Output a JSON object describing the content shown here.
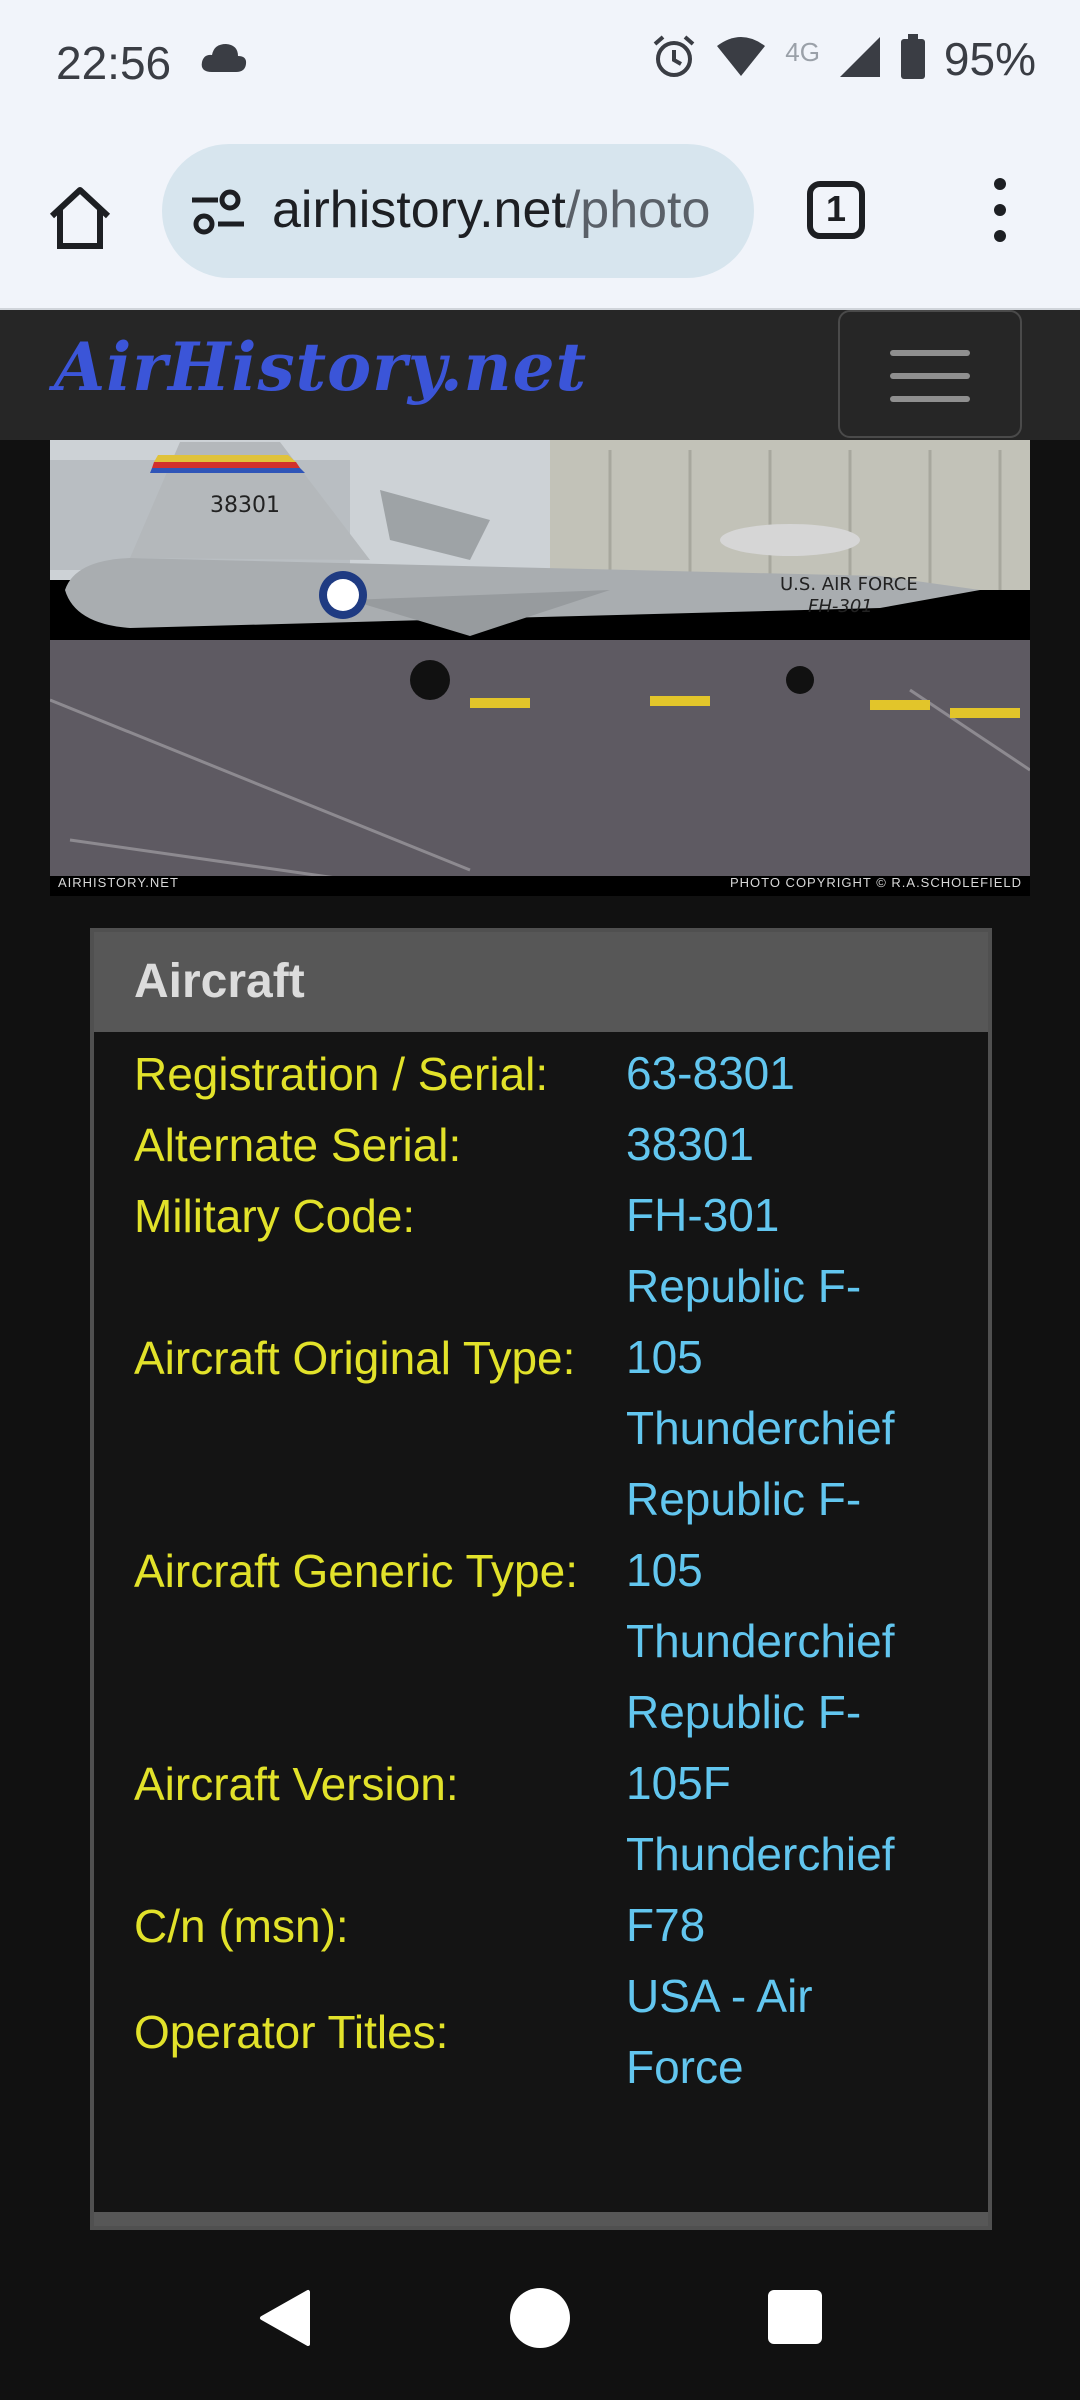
{
  "status": {
    "time": "22:56",
    "network": "4G",
    "battery": "95%"
  },
  "browser": {
    "url_main": "airhistory.net",
    "url_path": "/photo",
    "tab_count": "1"
  },
  "site": {
    "logo": "AirHistory.net"
  },
  "photo": {
    "caption_left": "AIRHISTORY.NET",
    "caption_right": "PHOTO COPYRIGHT © R.A.SCHOLEFIELD",
    "tail_number": "38301",
    "nose_text_1": "U.S. AIR FORCE",
    "nose_text_2": "FH-301"
  },
  "panel": {
    "title": "Aircraft",
    "rows": [
      {
        "label": "Registration / Serial:",
        "value": "63-8301"
      },
      {
        "label": "Alternate Serial:",
        "value": "38301"
      },
      {
        "label": "Military Code:",
        "value": "FH-301"
      },
      {
        "label": "Aircraft Original Type:",
        "value": "Republic F-105 Thunderchief"
      },
      {
        "label": "Aircraft Generic Type:",
        "value": "Republic F-105 Thunderchief"
      },
      {
        "label": "Aircraft Version:",
        "value": "Republic F-105F Thunderchief"
      },
      {
        "label": "C/n (msn):",
        "value": "F78"
      },
      {
        "label": "Operator Titles:",
        "value": "USA - Air Force"
      }
    ]
  },
  "colors": {
    "label": "#e2e22a",
    "value": "#62c6ef",
    "logo": "#3b55d8"
  }
}
